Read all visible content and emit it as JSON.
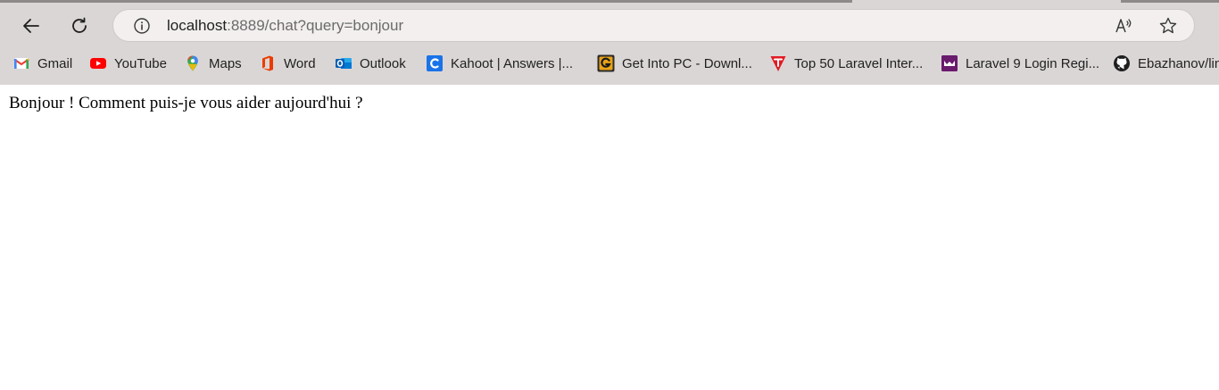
{
  "browser": {
    "address_bar": {
      "host": "localhost",
      "rest": ":8889/chat?query=bonjour"
    },
    "bookmarks": [
      {
        "label": "Gmail",
        "icon": "gmail-icon"
      },
      {
        "label": "YouTube",
        "icon": "youtube-icon"
      },
      {
        "label": "Maps",
        "icon": "maps-icon"
      },
      {
        "label": "Word",
        "icon": "office-icon"
      },
      {
        "label": "Outlook",
        "icon": "outlook-icon"
      },
      {
        "label": "Kahoot | Answers |...",
        "icon": "kahoot-icon"
      },
      {
        "label": "Get Into PC - Downl...",
        "icon": "getintopc-icon"
      },
      {
        "label": "Top 50 Laravel Inter...",
        "icon": "laravel-icon"
      },
      {
        "label": "Laravel 9 Login Regi...",
        "icon": "purple-site-icon"
      },
      {
        "label": "Ebazhanov/lin",
        "icon": "github-icon"
      }
    ],
    "colors": {
      "chrome_bg": "#dbd6d6",
      "omnibox_bg": "#f3efef"
    }
  },
  "page": {
    "message": "Bonjour ! Comment puis-je vous aider aujourd'hui ?"
  }
}
